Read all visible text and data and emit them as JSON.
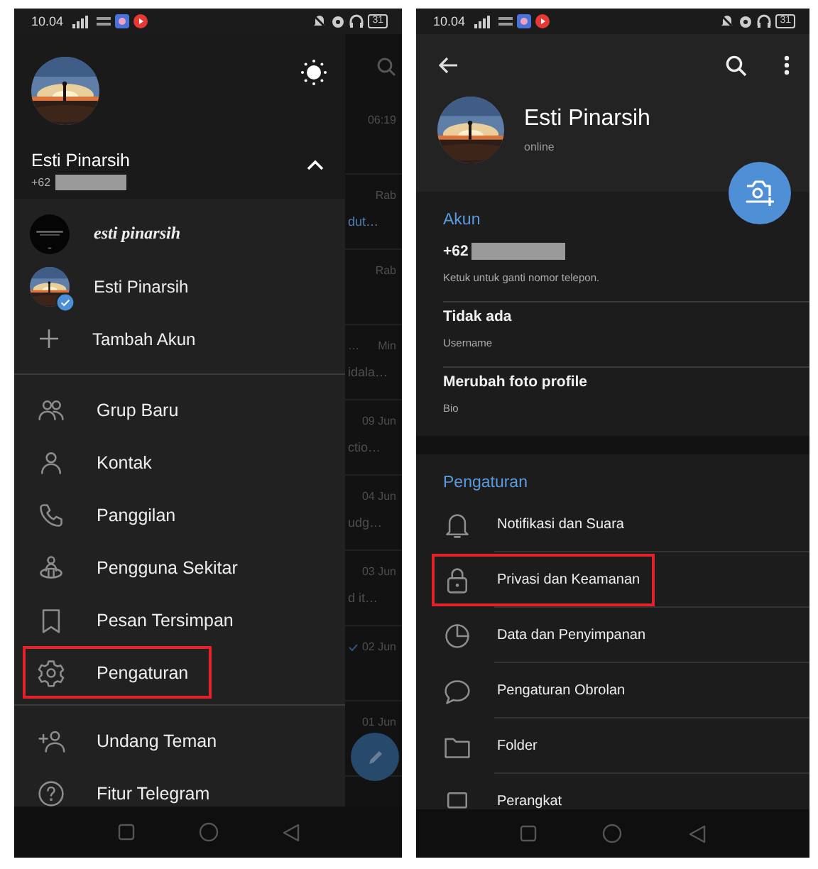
{
  "left_phone": {
    "status_bar": {
      "time": "10.04",
      "battery": "31"
    },
    "chat_list": [
      {
        "time": "06:19",
        "read": false
      },
      {
        "time": "Rab",
        "snippet": "dut…",
        "accent": true,
        "read": false
      },
      {
        "time": "Rab",
        "read": false
      },
      {
        "title": "…",
        "time": "Min",
        "snippet": "idala…",
        "accent": false,
        "read": false
      },
      {
        "time": "09 Jun",
        "snippet": "ctio…",
        "accent": false,
        "read": false
      },
      {
        "time": "04 Jun",
        "snippet": "udg…",
        "accent": false,
        "read": false
      },
      {
        "time": "03 Jun",
        "snippet": "d it…",
        "accent": false,
        "read": false
      },
      {
        "time": "02 Jun",
        "read": true
      },
      {
        "time": "01 Jun",
        "read": false
      }
    ],
    "drawer": {
      "profile": {
        "name": "Esti Pinarsih",
        "phone": "+62",
        "redacted": true
      },
      "accounts_expanded": true,
      "accounts": [
        {
          "name": "esti pinarsih",
          "kind": "dark",
          "selected": false
        },
        {
          "name": "Esti Pinarsih",
          "kind": "sunset",
          "selected": true
        }
      ],
      "add_account": "Tambah Akun",
      "menu": [
        {
          "kind": "group",
          "label": "Grup Baru",
          "highlighted": false
        },
        {
          "kind": "person",
          "label": "Kontak",
          "highlighted": false
        },
        {
          "kind": "phone",
          "label": "Panggilan",
          "highlighted": false
        },
        {
          "kind": "nearby",
          "label": "Pengguna Sekitar",
          "highlighted": false
        },
        {
          "kind": "bookmark",
          "label": "Pesan Tersimpan",
          "highlighted": false
        },
        {
          "kind": "gear",
          "label": "Pengaturan",
          "highlighted": true
        }
      ],
      "menu_extra": [
        {
          "kind": "invite",
          "label": "Undang Teman",
          "highlighted": false
        },
        {
          "kind": "help",
          "label": "Fitur Telegram",
          "highlighted": false
        }
      ]
    }
  },
  "right_phone": {
    "status_bar": {
      "time": "10.04",
      "battery": "31"
    },
    "profile": {
      "name": "Esti Pinarsih",
      "status": "online"
    },
    "account_section": {
      "title": "Akun",
      "rows": [
        {
          "value": "+62",
          "hint": "Ketuk untuk ganti nomor telepon.",
          "redacted": true
        },
        {
          "value": "Tidak ada",
          "hint": "Username",
          "redacted": false
        },
        {
          "value": "Merubah foto profile",
          "hint": "Bio",
          "redacted": false
        }
      ]
    },
    "settings_section": {
      "title": "Pengaturan",
      "items": [
        {
          "kind": "bell",
          "label": "Notifikasi dan Suara",
          "highlighted": false
        },
        {
          "kind": "lock",
          "label": "Privasi dan Keamanan",
          "highlighted": true
        },
        {
          "kind": "pie",
          "label": "Data dan Penyimpanan",
          "highlighted": false
        },
        {
          "kind": "bubble",
          "label": "Pengaturan Obrolan",
          "highlighted": false
        },
        {
          "kind": "folder",
          "label": "Folder",
          "highlighted": false
        },
        {
          "kind": "laptop",
          "label": "Perangkat",
          "highlighted": false
        }
      ]
    }
  }
}
